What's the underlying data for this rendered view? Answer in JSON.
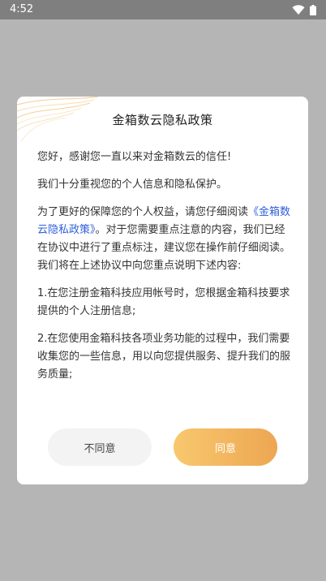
{
  "status_bar": {
    "time": "4:52"
  },
  "dialog": {
    "title": "金箱数云隐私政策",
    "para1": "您好，感谢您一直以来对金箱数云的信任!",
    "para2": "我们十分重视您的个人信息和隐私保护。",
    "para3_lead": "为了更好的保障您的个人权益，请您仔细阅读",
    "para3_link": "《金箱数云隐私政策》",
    "para3_tail": "。对于您需要重点注意的内容，我们已经在协议中进行了重点标注，建议您在操作前仔细阅读。我们将在上述协议中向您重点说明下述内容:",
    "para4": "1.在您注册金箱科技应用帐号时，您根据金箱科技要求提供的个人注册信息;",
    "para5": "2.在您使用金箱科技各项业务功能的过程中，我们需要收集您的一些信息，用以向您提供服务、提升我们的服务质量;",
    "disagree_label": "不同意",
    "agree_label": "同意"
  },
  "icons": [
    "wifi-icon",
    "battery-icon"
  ],
  "colors": {
    "accent": "#f0aa56",
    "link": "#2f5fd8",
    "scrim": "#b5b5b5"
  }
}
